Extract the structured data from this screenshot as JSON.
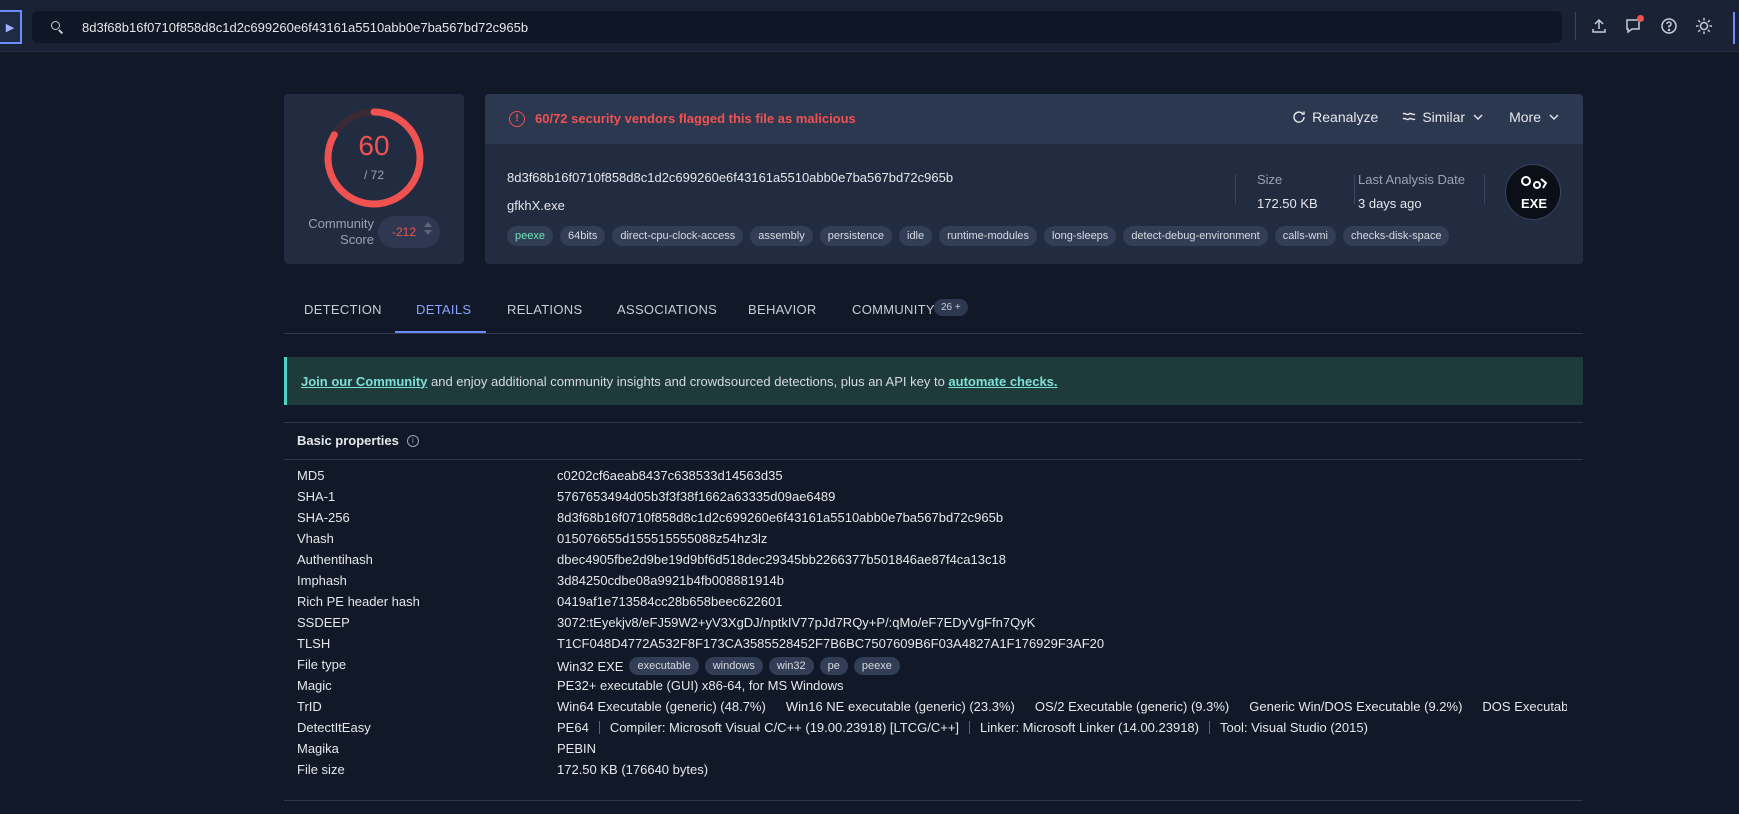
{
  "topbar": {
    "search_value": "8d3f68b16f0710f858d8c1d2c699260e6f43161a5510abb0e7ba567bd72c965b",
    "icons": [
      "upload-icon",
      "chat-icon",
      "help-icon",
      "theme-icon"
    ]
  },
  "score": {
    "detected": "60",
    "total": "/ 72",
    "detected_fraction": 0.833,
    "community_label": "Community Score",
    "community_value": "-212"
  },
  "alert": {
    "text": "60/72 security vendors flagged this file as malicious",
    "actions": {
      "reanalyze": "Reanalyze",
      "similar": "Similar",
      "more": "More"
    }
  },
  "file": {
    "hash": "8d3f68b16f0710f858d8c1d2c699260e6f43161a5510abb0e7ba567bd72c965b",
    "name": "gfkhX.exe",
    "tags": [
      "peexe",
      "64bits",
      "direct-cpu-clock-access",
      "assembly",
      "persistence",
      "idle",
      "runtime-modules",
      "long-sleeps",
      "detect-debug-environment",
      "calls-wmi",
      "checks-disk-space"
    ],
    "size_label": "Size",
    "size_value": "172.50 KB",
    "date_label": "Last Analysis Date",
    "date_value": "3 days ago",
    "type_badge": "EXE"
  },
  "tabs": [
    {
      "label": "DETECTION"
    },
    {
      "label": "DETAILS"
    },
    {
      "label": "RELATIONS"
    },
    {
      "label": "ASSOCIATIONS"
    },
    {
      "label": "BEHAVIOR"
    },
    {
      "label": "COMMUNITY"
    }
  ],
  "tab_badge": "26 +",
  "banner": {
    "link1": "Join our Community",
    "middle": " and enjoy additional community insights and crowdsourced detections, plus an API key to ",
    "link2": "automate checks."
  },
  "basic": {
    "title": "Basic properties",
    "md5_k": "MD5",
    "md5_v": "c0202cf6aeab8437c638533d14563d35",
    "sha1_k": "SHA-1",
    "sha1_v": "5767653494d05b3f3f38f1662a63335d09ae6489",
    "sha256_k": "SHA-256",
    "sha256_v": "8d3f68b16f0710f858d8c1d2c699260e6f43161a5510abb0e7ba567bd72c965b",
    "vhash_k": "Vhash",
    "vhash_v": "015076655d155515555088z54hz3lz",
    "auth_k": "Authentihash",
    "auth_v": "dbec4905fbe2d9be19d9bf6d518dec29345bb2266377b501846ae87f4ca13c18",
    "imp_k": "Imphash",
    "imp_v": "3d84250cdbe08a9921b4fb008881914b",
    "rich_k": "Rich PE header hash",
    "rich_v": "0419af1e713584cc28b658beec622601",
    "ssdeep_k": "SSDEEP",
    "ssdeep_v": "3072:tEyekjv8/eFJ59W2+yV3XgDJ/nptkIV77pJd7RQy+P/:qMo/eF7EDyVgFfn7QyK",
    "tlsh_k": "TLSH",
    "tlsh_v": "T1CF048D4772A532F8F173CA3585528452F7B6BC7507609B6F03A4827A1F176929F3AF20",
    "ftype_k": "File type",
    "ftype_v": "Win32 EXE",
    "ftype_tags": [
      "executable",
      "windows",
      "win32",
      "pe",
      "peexe"
    ],
    "magic_k": "Magic",
    "magic_v": "PE32+ executable (GUI) x86-64, for MS Windows",
    "trid_k": "TrID",
    "trid_v": [
      "Win64 Executable (generic) (48.7%)",
      "Win16 NE executable (generic) (23.3%)",
      "OS/2 Executable (generic) (9.3%)",
      "Generic Win/DOS Executable (9.2%)",
      "DOS Executable…"
    ],
    "die_k": "DetectItEasy",
    "die_v": [
      "PE64",
      "Compiler: Microsoft Visual C/C++ (19.00.23918) [LTCG/C++]",
      "Linker: Microsoft Linker (14.00.23918)",
      "Tool: Visual Studio (2015)"
    ],
    "magika_k": "Magika",
    "magika_v": "PEBIN",
    "fsize_k": "File size",
    "fsize_v": "172.50 KB (176640 bytes)"
  }
}
